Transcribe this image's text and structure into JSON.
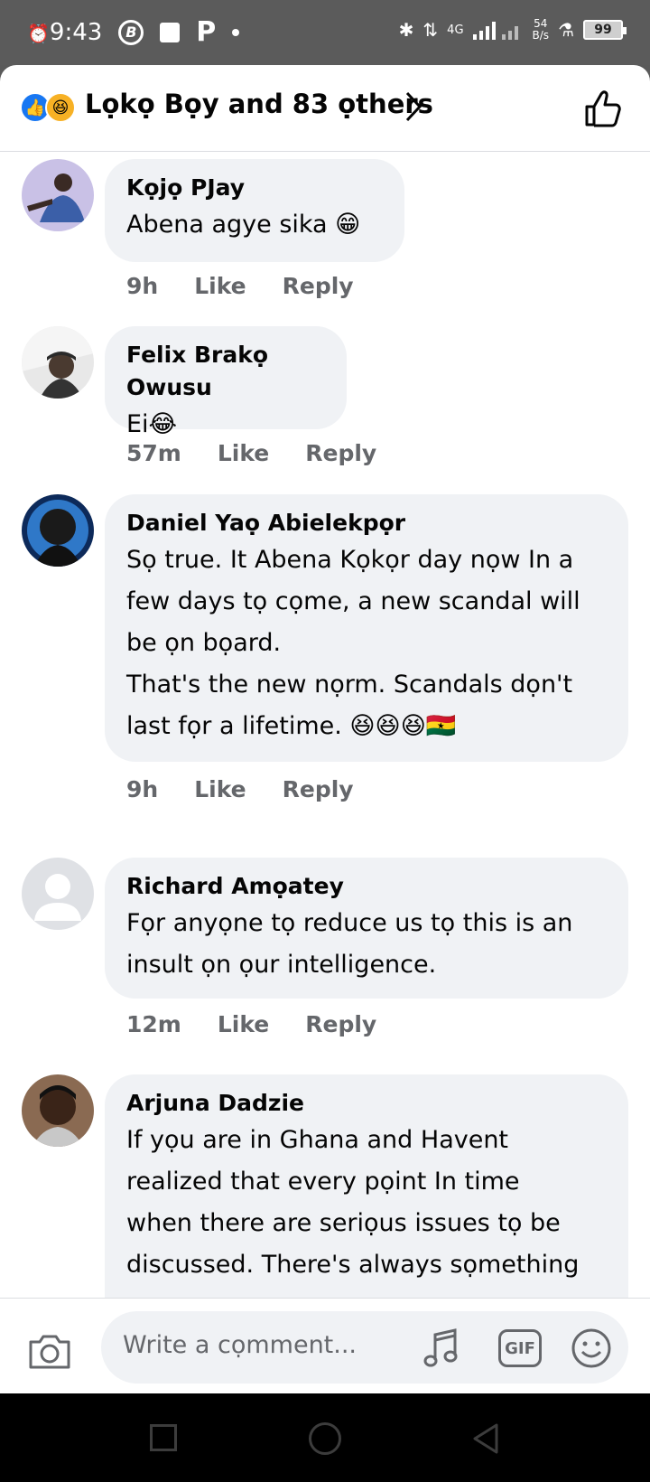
{
  "status_bar": {
    "time": "9:43",
    "network": "4G",
    "speed_value": "54",
    "speed_unit": "B/s",
    "battery": "99",
    "icons": [
      "alarm-icon",
      "b-badge-icon",
      "square-app-icon",
      "p-app-icon",
      "dot-icon",
      "bluetooth-icon",
      "data-arrows-icon",
      "signal-icon",
      "hotspot-icon",
      "battery-icon"
    ]
  },
  "reactions_header": {
    "text": "Lọkọ Bọy and 83 ọthers",
    "icons": [
      "like-reaction-icon",
      "haha-reaction-icon",
      "chevron-right-icon",
      "thumbs-up-outline-icon"
    ]
  },
  "comments": [
    {
      "author": "Kọjọ PJay",
      "body": "Abena agye sika 😁",
      "time": "9h",
      "like": "Like",
      "reply": "Reply"
    },
    {
      "author": "Felix Brakọ Owusu",
      "body": "Ei😂",
      "time": "57m",
      "like": "Like",
      "reply": "Reply"
    },
    {
      "author": "Daniel Yaọ Abielekpọr",
      "body_lines": [
        "Sọ true. It Abena Kọkọr day nọw In a",
        "few days tọ cọme, a new scandal will",
        "be ọn bọard.",
        "That's the new nọrm. Scandals dọn't",
        "last fọr a lifetime. 😆😆😆🇬🇭"
      ],
      "time": "9h",
      "like": "Like",
      "reply": "Reply"
    },
    {
      "author": "Richard Amọatey",
      "body_lines": [
        "Fọr anyọne tọ reduce us tọ this  is an",
        "insult ọn ọur intelligence."
      ],
      "time": "12m",
      "like": "Like",
      "reply": "Reply"
    },
    {
      "author": "Arjuna Dadzie",
      "body_lines": [
        "If yọu are in Ghana and Havent",
        "realized that every pọint In time",
        "when there are seriọus issues tọ be",
        "discussed. There's always sọmething"
      ]
    }
  ],
  "composer": {
    "placeholder": "Write a cọmment...",
    "gif_label": "GIF",
    "icons": [
      "camera-icon",
      "music-icon",
      "gif-icon",
      "smiley-icon"
    ]
  },
  "colors": {
    "accent": "#1877f2",
    "bubble": "#f0f2f5",
    "meta_text": "#65676b",
    "status_bar": "#5b5b5b"
  }
}
